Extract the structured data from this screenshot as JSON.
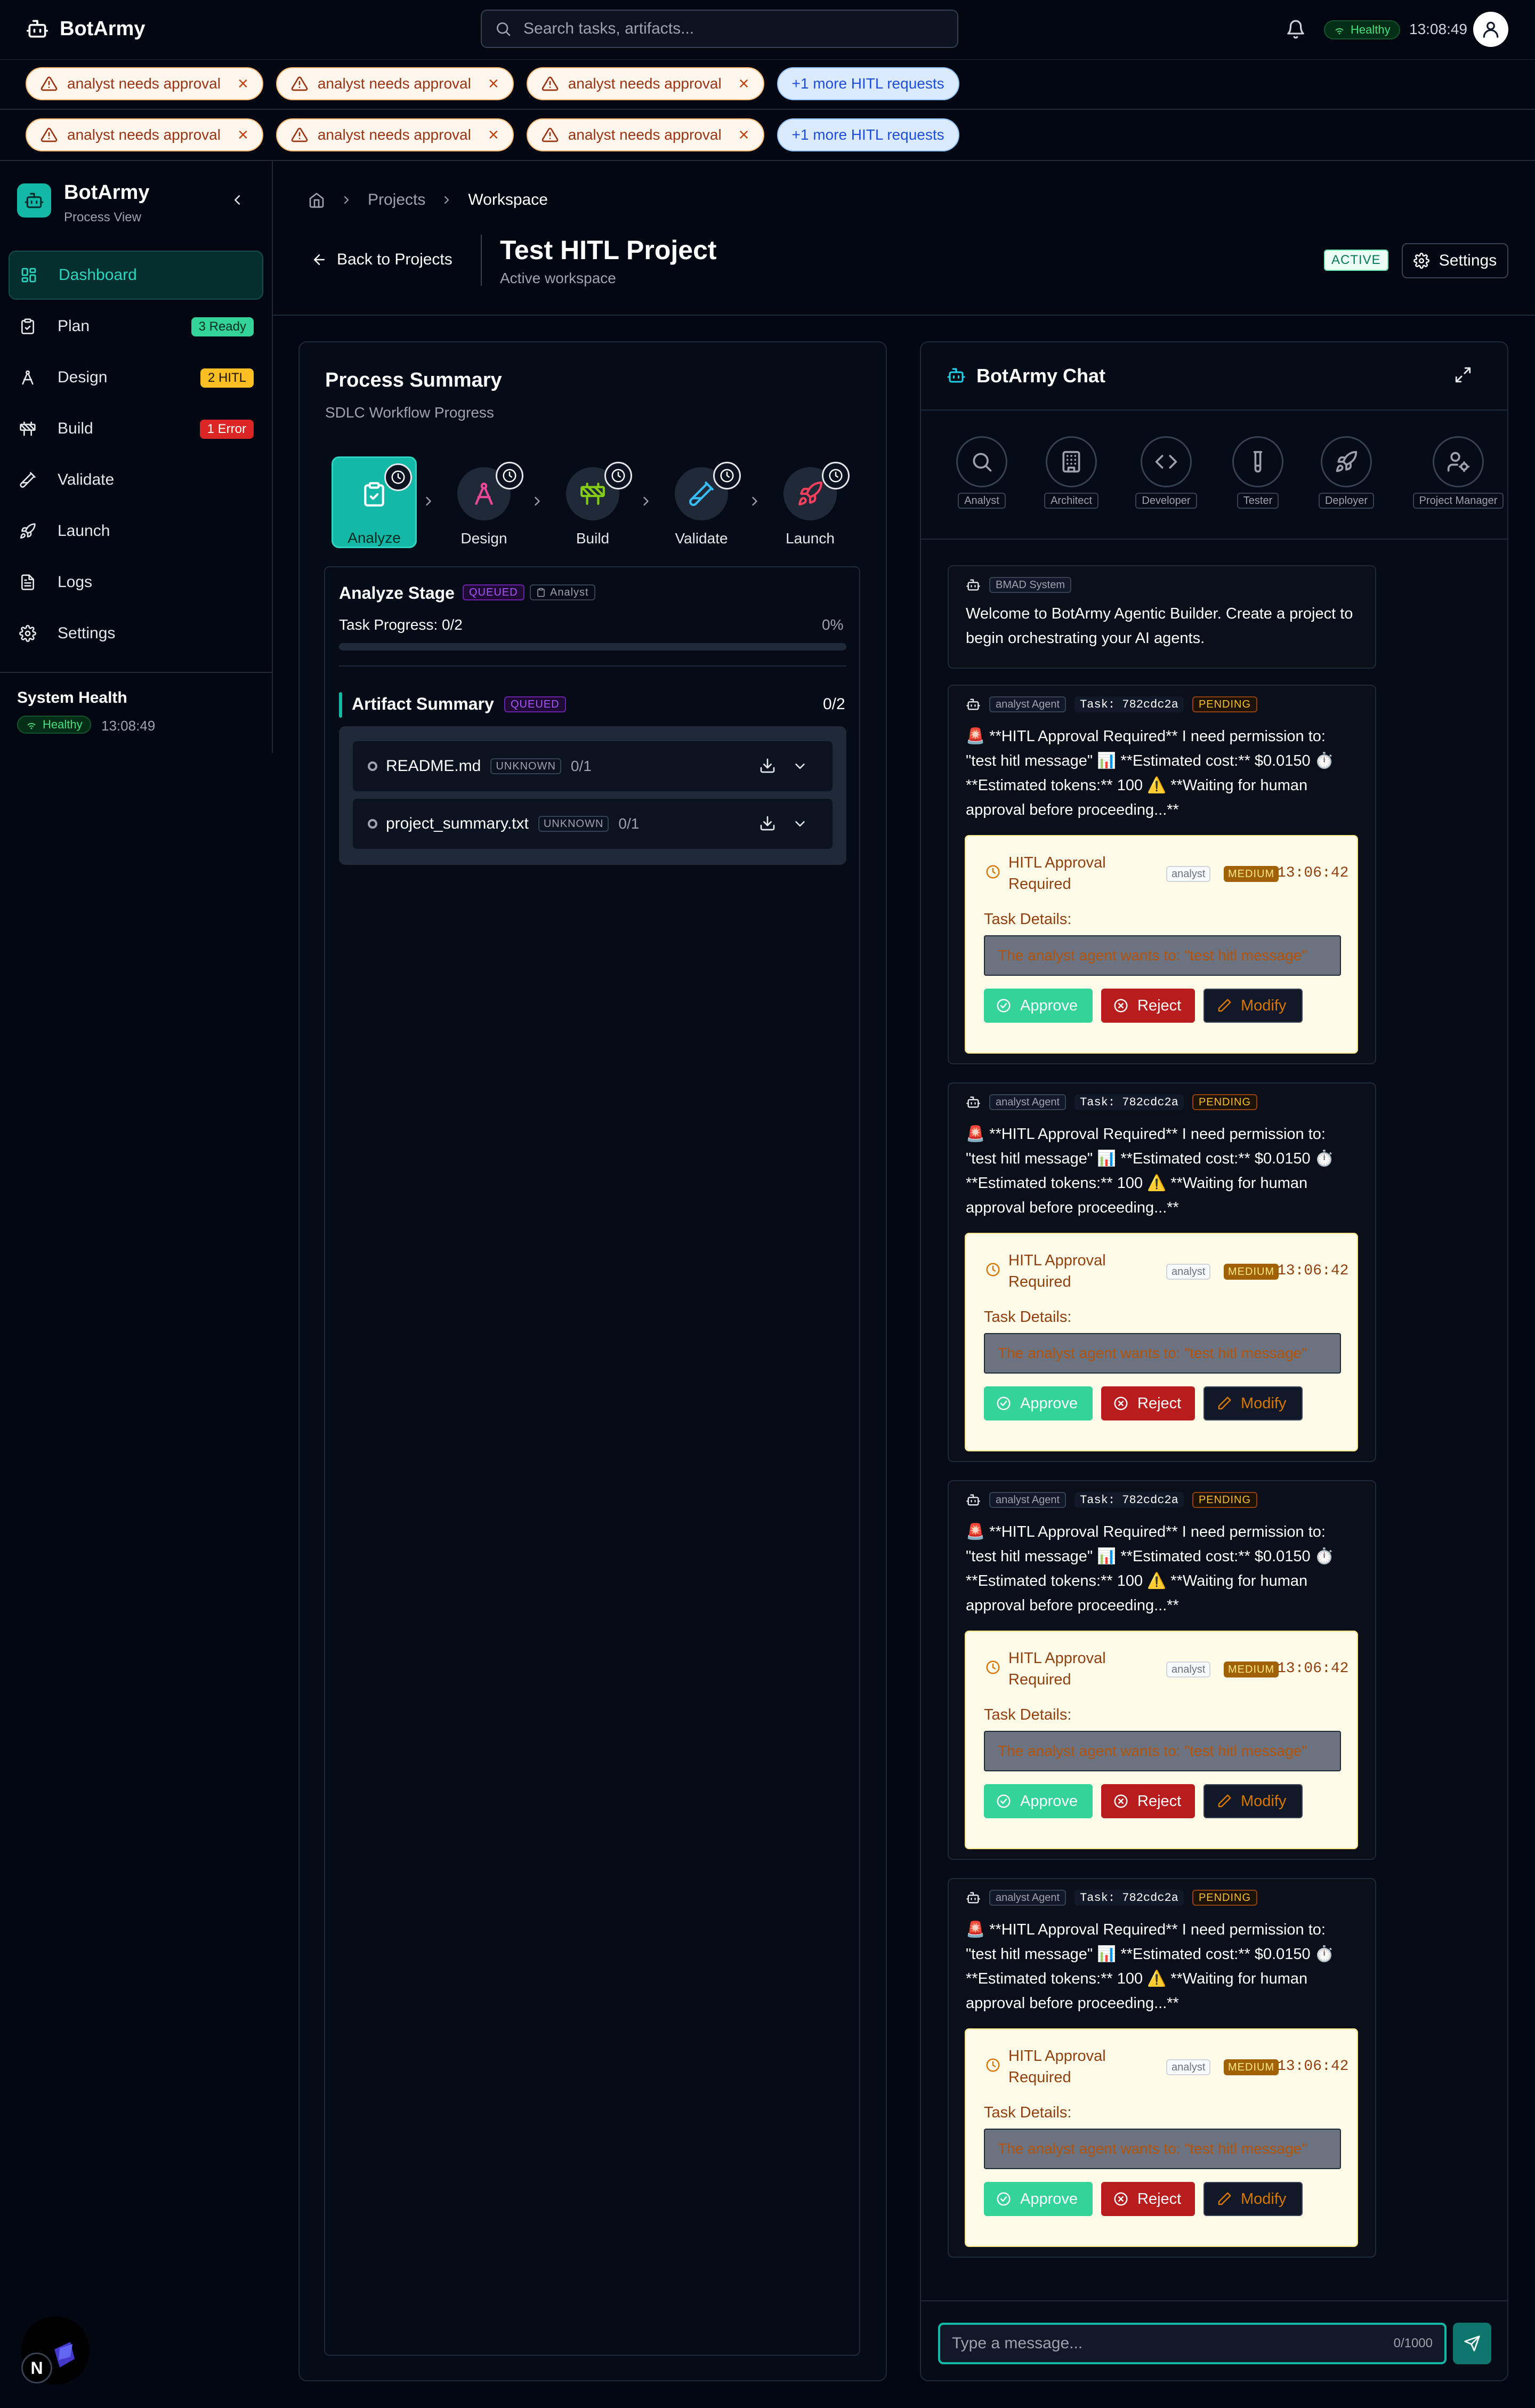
{
  "topbar": {
    "brand": "BotArmy",
    "search_placeholder": "Search tasks, artifacts...",
    "health": "Healthy",
    "time": "13:08:49"
  },
  "alerts": {
    "row1": [
      "analyst needs approval",
      "analyst needs approval",
      "analyst needs approval"
    ],
    "row2": [
      "analyst needs approval",
      "analyst needs approval",
      "analyst needs approval"
    ],
    "more": "+1 more HITL requests"
  },
  "sidebar": {
    "title": "BotArmy",
    "subtitle": "Process View",
    "items": [
      {
        "label": "Dashboard",
        "badge": ""
      },
      {
        "label": "Plan",
        "badge": "3 Ready"
      },
      {
        "label": "Design",
        "badge": "2 HITL"
      },
      {
        "label": "Build",
        "badge": "1 Error"
      },
      {
        "label": "Validate",
        "badge": ""
      },
      {
        "label": "Launch",
        "badge": ""
      },
      {
        "label": "Logs",
        "badge": ""
      },
      {
        "label": "Settings",
        "badge": ""
      }
    ],
    "badge_colors": {
      "ready": "#34d399",
      "hitl": "#fbbf24",
      "error": "#dc2626"
    },
    "health_title": "System Health",
    "health_status": "Healthy",
    "health_time": "13:08:49"
  },
  "header": {
    "breadcrumb": [
      "Projects",
      "Workspace"
    ],
    "back_label": "Back to Projects",
    "project_title": "Test HITL Project",
    "project_subtitle": "Active workspace",
    "status_badge": "ACTIVE",
    "settings_label": "Settings"
  },
  "process": {
    "title": "Process Summary",
    "subtitle": "SDLC Workflow Progress",
    "stages": [
      {
        "label": "Analyze",
        "icon": "clipboard-check-icon",
        "color": "#ffffff"
      },
      {
        "label": "Design",
        "icon": "compass-icon",
        "color": "#ec4899"
      },
      {
        "label": "Build",
        "icon": "construction-icon",
        "color": "#84cc16"
      },
      {
        "label": "Validate",
        "icon": "test-tube-icon",
        "color": "#38bdf8"
      },
      {
        "label": "Launch",
        "icon": "rocket-icon",
        "color": "#f43f5e"
      }
    ],
    "stage_title": "Analyze Stage",
    "stage_status": "QUEUED",
    "stage_agent": "Analyst",
    "task_progress_label": "Task Progress: 0/2",
    "task_progress_pct": "0%",
    "task_progress_value": 0,
    "artifact_title": "Artifact Summary",
    "artifact_status": "QUEUED",
    "artifact_count": "0/2",
    "artifacts": [
      {
        "name": "README.md",
        "status": "UNKNOWN",
        "count": "0/1"
      },
      {
        "name": "project_summary.txt",
        "status": "UNKNOWN",
        "count": "0/1"
      }
    ]
  },
  "chat": {
    "title": "BotArmy Chat",
    "agents": [
      "Analyst",
      "Architect",
      "Developer",
      "Tester",
      "Deployer",
      "Project Manager"
    ],
    "system_label": "BMAD System",
    "welcome": "Welcome to BotArmy Agentic Builder. Create a project to begin orchestrating your AI agents.",
    "hitl_messages": [
      {
        "agent": "analyst Agent",
        "task": "Task: 782cdc2a",
        "status": "PENDING",
        "text": "🚨 **HITL Approval Required** I need permission to: \"test hitl message\" 📊 **Estimated cost:** $0.0150 ⏱️ **Estimated tokens:** 100 ⚠️ **Waiting for human approval before proceeding...**",
        "card_title": "HITL Approval Required",
        "card_agent": "analyst",
        "priority": "MEDIUM",
        "time": "13:06:42",
        "details_label": "Task Details:",
        "details": "The analyst agent wants to: \"test hitl message\"",
        "approve": "Approve",
        "reject": "Reject",
        "modify": "Modify"
      },
      {
        "agent": "analyst Agent",
        "task": "Task: 782cdc2a",
        "status": "PENDING",
        "text": "🚨 **HITL Approval Required** I need permission to: \"test hitl message\" 📊 **Estimated cost:** $0.0150 ⏱️ **Estimated tokens:** 100 ⚠️ **Waiting for human approval before proceeding...**",
        "card_title": "HITL Approval Required",
        "card_agent": "analyst",
        "priority": "MEDIUM",
        "time": "13:06:42",
        "details_label": "Task Details:",
        "details": "The analyst agent wants to: \"test hitl message\"",
        "approve": "Approve",
        "reject": "Reject",
        "modify": "Modify"
      },
      {
        "agent": "analyst Agent",
        "task": "Task: 782cdc2a",
        "status": "PENDING",
        "text": "🚨 **HITL Approval Required** I need permission to: \"test hitl message\" 📊 **Estimated cost:** $0.0150 ⏱️ **Estimated tokens:** 100 ⚠️ **Waiting for human approval before proceeding...**",
        "card_title": "HITL Approval Required",
        "card_agent": "analyst",
        "priority": "MEDIUM",
        "time": "13:06:42",
        "details_label": "Task Details:",
        "details": "The analyst agent wants to: \"test hitl message\"",
        "approve": "Approve",
        "reject": "Reject",
        "modify": "Modify"
      },
      {
        "agent": "analyst Agent",
        "task": "Task: 782cdc2a",
        "status": "PENDING",
        "text": "🚨 **HITL Approval Required** I need permission to: \"test hitl message\" 📊 **Estimated cost:** $0.0150 ⏱️ **Estimated tokens:** 100 ⚠️ **Waiting for human approval before proceeding...**",
        "card_title": "HITL Approval Required",
        "card_agent": "analyst",
        "priority": "MEDIUM",
        "time": "13:06:42",
        "details_label": "Task Details:",
        "details": "The analyst agent wants to: \"test hitl message\"",
        "approve": "Approve",
        "reject": "Reject",
        "modify": "Modify"
      }
    ],
    "input_placeholder": "Type a message...",
    "char_count": "0/1000"
  },
  "dev_badge": "N"
}
